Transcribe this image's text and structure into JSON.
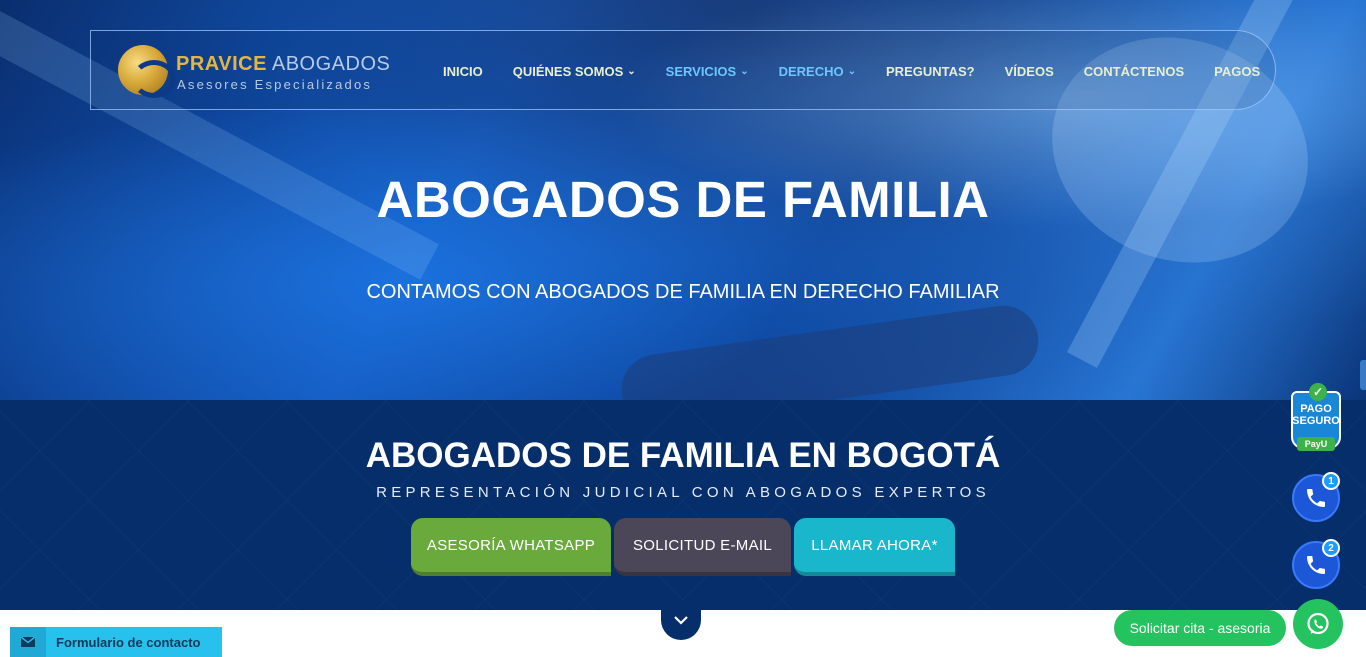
{
  "brand": {
    "name_part1": "PRAVICE",
    "name_part2": "ABOGADOS",
    "tagline": "Asesores Especializados"
  },
  "nav": {
    "items": [
      {
        "label": "INICIO",
        "dropdown": false,
        "highlight": false
      },
      {
        "label": "QUIÉNES SOMOS",
        "dropdown": true,
        "highlight": false
      },
      {
        "label": "SERVICIOS",
        "dropdown": true,
        "highlight": true
      },
      {
        "label": "DERECHO",
        "dropdown": true,
        "highlight": true
      },
      {
        "label": "PREGUNTAS?",
        "dropdown": false,
        "highlight": false
      },
      {
        "label": "VÍDEOS",
        "dropdown": false,
        "highlight": false
      },
      {
        "label": "CONTÁCTENOS",
        "dropdown": false,
        "highlight": false
      },
      {
        "label": "PAGOS",
        "dropdown": false,
        "highlight": false
      }
    ]
  },
  "hero": {
    "title": "ABOGADOS DE FAMILIA",
    "subtitle": "CONTAMOS CON ABOGADOS DE FAMILIA EN DERECHO FAMILIAR"
  },
  "band": {
    "title": "ABOGADOS DE FAMILIA EN BOGOTÁ",
    "subtitle": "REPRESENTACIÓN JUDICIAL CON ABOGADOS EXPERTOS",
    "buttons": {
      "whatsapp": "ASESORÍA WHATSAPP",
      "email": "SOLICITUD E-MAIL",
      "call": "LLAMAR AHORA*"
    }
  },
  "floating": {
    "pago_line1": "PAGO",
    "pago_line2": "SEGURO",
    "payu": "PayU",
    "call1_badge": "1",
    "call2_badge": "2",
    "cita_label": "Solicitar cita - asesoria",
    "contact_form_label": "Formulario de contacto"
  },
  "colors": {
    "whatsapp_green": "#6aa93c",
    "email_gray": "#4b4658",
    "call_cyan": "#1ab7cc",
    "band_navy": "#062e6b",
    "brand_gold": "#e2b640",
    "nav_highlight": "#6cc6ff"
  },
  "icons": [
    "chevron-down-icon",
    "envelope-icon",
    "phone-icon",
    "whatsapp-icon",
    "check-icon"
  ]
}
